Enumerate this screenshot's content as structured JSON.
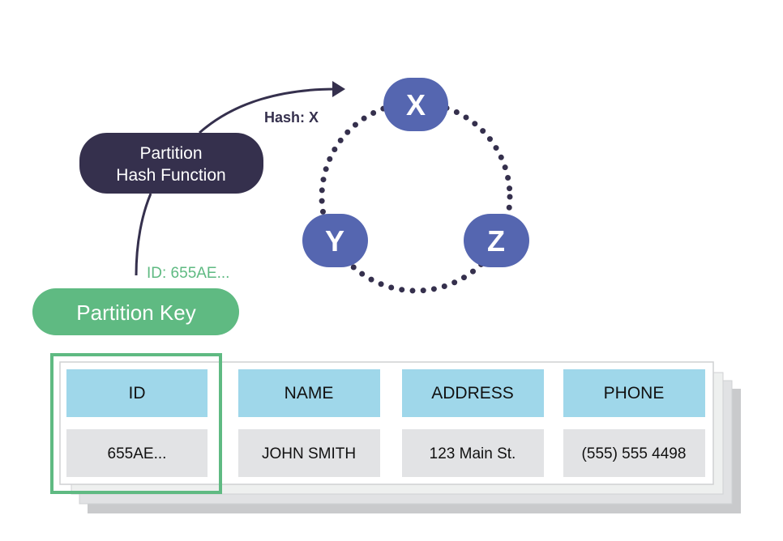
{
  "hash_function": {
    "line1": "Partition",
    "line2": "Hash Function"
  },
  "hash_label": "Hash: X",
  "id_label": "ID: 655AE...",
  "partition_key": "Partition Key",
  "nodes": [
    "X",
    "Y",
    "Z"
  ],
  "table": {
    "headers": [
      "ID",
      "NAME",
      "ADDRESS",
      "PHONE"
    ],
    "row": [
      "655AE...",
      "JOHN SMITH",
      "123 Main St.",
      "(555) 555 4498"
    ]
  },
  "colors": {
    "dark": "#35304d",
    "green": "#5fba82",
    "node": "#5566b0",
    "header": "#9fd7ea",
    "cell": "#e2e3e5"
  }
}
